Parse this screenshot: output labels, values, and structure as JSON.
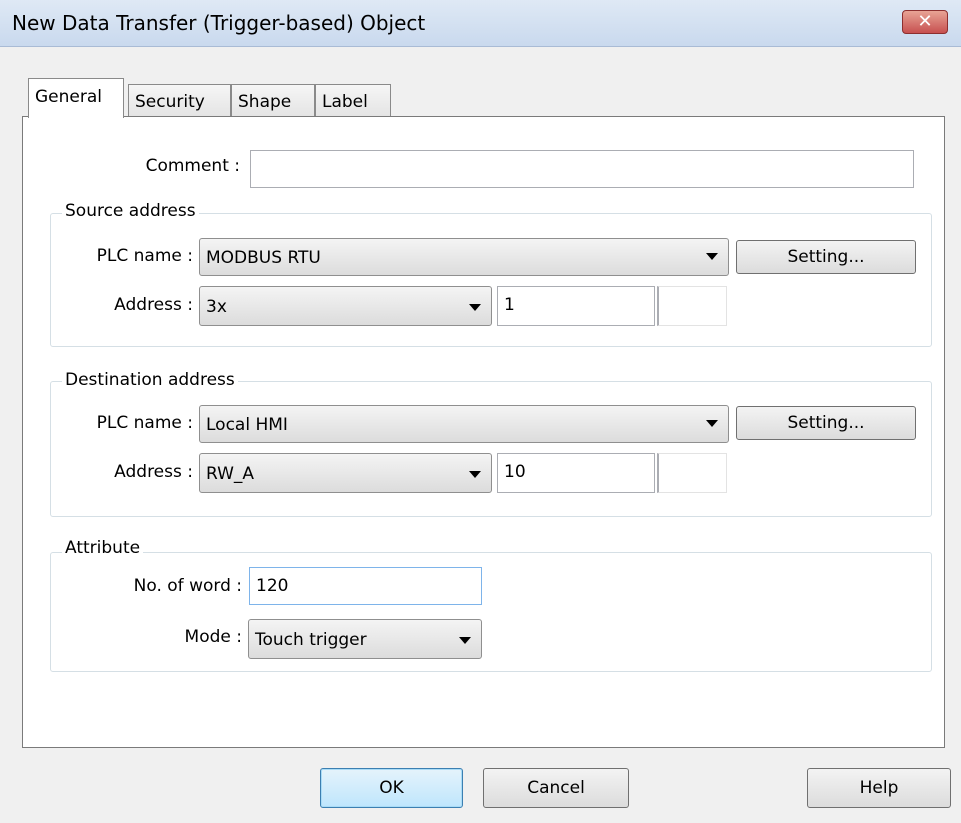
{
  "window": {
    "title": "New  Data Transfer (Trigger-based) Object",
    "close_label": "✕"
  },
  "tabs": [
    {
      "label": "General",
      "active": true
    },
    {
      "label": "Security",
      "active": false
    },
    {
      "label": "Shape",
      "active": false
    },
    {
      "label": "Label",
      "active": false
    }
  ],
  "general": {
    "comment_label": "Comment :",
    "comment_value": "",
    "source": {
      "legend": "Source address",
      "plc_label": "PLC name :",
      "plc_value": "MODBUS RTU",
      "setting_label": "Setting...",
      "address_label": "Address :",
      "address_type": "3x",
      "address_value": "1",
      "address_index": ""
    },
    "destination": {
      "legend": "Destination address",
      "plc_label": "PLC name :",
      "plc_value": "Local HMI",
      "setting_label": "Setting...",
      "address_label": "Address :",
      "address_type": "RW_A",
      "address_value": "10",
      "address_index": ""
    },
    "attribute": {
      "legend": "Attribute",
      "words_label": "No. of word :",
      "words_value": "120",
      "mode_label": "Mode :",
      "mode_value": "Touch trigger"
    }
  },
  "footer": {
    "ok_label": "OK",
    "cancel_label": "Cancel",
    "help_label": "Help"
  },
  "colors": {
    "title_bar": "#c9d9ee",
    "close_button": "#c75050",
    "default_button": "#bee6fd",
    "panel": "#ffffff",
    "background": "#f0f0f0"
  }
}
